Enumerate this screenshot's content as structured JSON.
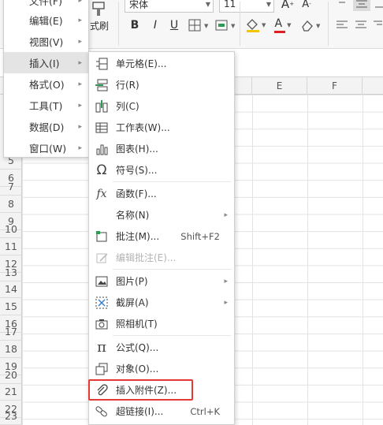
{
  "ribbon": {
    "brush_label": "式刷",
    "font_name": "宋体",
    "font_size": "11",
    "grow_font": "A",
    "shrink_font": "A",
    "bold": "B",
    "italic": "I",
    "underline": "U",
    "font_color_glyph": "A"
  },
  "columns": [
    "E",
    "F"
  ],
  "rows": [
    "5",
    "6",
    "7",
    "8",
    "9",
    "10",
    "11",
    "12",
    "13",
    "14",
    "15",
    "16",
    "17",
    "18",
    "19",
    "20",
    "21",
    "22",
    "23"
  ],
  "left_menu": [
    {
      "label": "文件(F)",
      "selected": false
    },
    {
      "label": "编辑(E)",
      "selected": false
    },
    {
      "label": "视图(V)",
      "selected": false
    },
    {
      "label": "插入(I)",
      "selected": true
    },
    {
      "label": "格式(O)",
      "selected": false
    },
    {
      "label": "工具(T)",
      "selected": false
    },
    {
      "label": "数据(D)",
      "selected": false
    },
    {
      "label": "窗口(W)",
      "selected": false
    }
  ],
  "insert_menu": [
    {
      "icon": "cell-icon",
      "label": "单元格(E)..."
    },
    {
      "icon": "row-icon",
      "label": "行(R)"
    },
    {
      "icon": "column-icon",
      "label": "列(C)"
    },
    {
      "icon": "worksheet-icon",
      "label": "工作表(W)..."
    },
    {
      "icon": "chart-icon",
      "label": "图表(H)..."
    },
    {
      "icon": "omega-icon",
      "label": "符号(S)..."
    },
    {
      "icon": "fx-icon",
      "label": "函数(F)..."
    },
    {
      "icon": "",
      "label": "名称(N)",
      "submenu": true
    },
    {
      "icon": "comment-icon",
      "label": "批注(M)...",
      "shortcut": "Shift+F2"
    },
    {
      "icon": "edit-comment-icon",
      "label": "编辑批注(E)...",
      "disabled": true
    },
    {
      "icon": "picture-icon",
      "label": "图片(P)",
      "submenu": true
    },
    {
      "icon": "screenshot-icon",
      "label": "截屏(A)",
      "submenu": true
    },
    {
      "icon": "camera-icon",
      "label": "照相机(T)"
    },
    {
      "icon": "pi-icon",
      "label": "公式(Q)..."
    },
    {
      "icon": "object-icon",
      "label": "对象(O)..."
    },
    {
      "icon": "paperclip-icon",
      "label": "插入附件(Z)...",
      "highlighted": true
    },
    {
      "icon": "link-icon",
      "label": "超链接(I)...",
      "shortcut": "Ctrl+K"
    }
  ],
  "colors": {
    "highlight_box": "#e53935",
    "menu_selected": "#e4e4e4",
    "icon_green": "#2e9b57",
    "fill_yellow": "#f5c400",
    "font_red": "#e02020"
  }
}
